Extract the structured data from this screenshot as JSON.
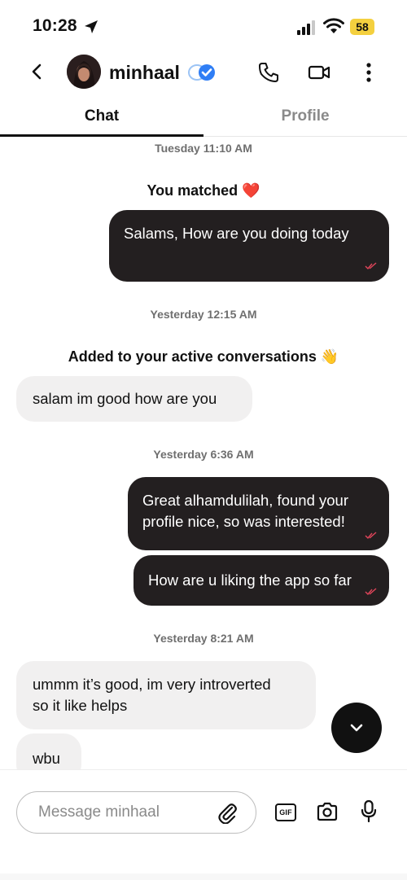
{
  "status_bar": {
    "time": "10:28",
    "battery": "58"
  },
  "header": {
    "name": "minhaal"
  },
  "tabs": [
    {
      "label": "Chat",
      "active": true
    },
    {
      "label": "Profile",
      "active": false
    }
  ],
  "messages": {
    "ts1": "Tuesday 11:10 AM",
    "sys1": "You matched ❤️",
    "m1": "Salams, How are you doing today",
    "ts2": "Yesterday 12:15 AM",
    "sys2": "Added to your active conversations 👋",
    "m2": "salam im good how are you",
    "ts3": "Yesterday 6:36 AM",
    "m3_line1": "Great alhamdulilah, found your",
    "m3_line2": "profile nice, so was interested!",
    "m4": "How are u liking the app so far",
    "ts4": "Yesterday 8:21 AM",
    "m5_line1": "ummm it’s good, im very introverted",
    "m5_line2": "so it like helps",
    "m6": "wbu"
  },
  "composer": {
    "placeholder": "Message minhaal",
    "gif_label": "GIF"
  },
  "colors": {
    "outgoing_bubble": "#231f20",
    "incoming_bubble": "#f1f0f0",
    "read_receipt": "#e0455a",
    "verified": "#2f7ef5"
  },
  "icons": [
    "location-arrow-icon",
    "signal-icon",
    "wifi-icon",
    "back-icon",
    "verified-icon",
    "phone-icon",
    "video-icon",
    "more-vertical-icon",
    "read-receipt-icon",
    "chevron-down-icon",
    "paperclip-icon",
    "camera-icon",
    "microphone-icon"
  ]
}
